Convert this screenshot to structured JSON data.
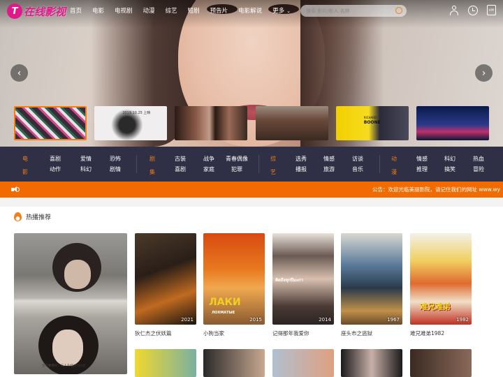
{
  "header": {
    "logo_mark": "T",
    "logo_text": "在线影视",
    "nav": [
      "首页",
      "电影",
      "电视剧",
      "动漫",
      "综艺",
      "短剧",
      "预告片",
      "电影解说",
      "更多"
    ],
    "nav_more_chevron": "⌄",
    "search_placeholder": "搜索 影片/影人 名称",
    "app_icon_text": "APP"
  },
  "hero": {
    "prev": "‹",
    "next": "›",
    "thumbnails": [
      {
        "label": ""
      },
      {
        "label": "2019.10.25 上映"
      },
      {
        "label": ""
      },
      {
        "label": ""
      },
      {
        "label_top": "RICHARD",
        "label": "BOONE"
      },
      {
        "label": ""
      }
    ]
  },
  "categories": [
    {
      "name": "电影",
      "items": [
        "喜剧",
        "爱情",
        "恐怖",
        "动作",
        "科幻",
        "剧情"
      ]
    },
    {
      "name": "剧集",
      "items": [
        "古装",
        "战争",
        "青春偶像",
        "喜剧",
        "家庭",
        "犯罪"
      ]
    },
    {
      "name": "综艺",
      "items": [
        "选秀",
        "情感",
        "访谈",
        "播报",
        "旅游",
        "音乐"
      ]
    },
    {
      "name": "动漫",
      "items": [
        "情感",
        "科幻",
        "热血",
        "推理",
        "搞笑",
        "冒险"
      ]
    }
  ],
  "notice": {
    "text": "公告：欢迎光临美丽影院，请记住我们的网址 www.wy"
  },
  "hot": {
    "title": "热播推荐",
    "big_poster_caption": "生の季節が、二人を結びつけた",
    "cards": [
      {
        "name": "狄仁杰之伏妖篇",
        "year": "2021",
        "poster_text": ""
      },
      {
        "name": "小狗当家",
        "year": "2015",
        "poster_text": "ЛАКИ",
        "poster_text2": "ЛОХМАТЫЕ"
      },
      {
        "name": "记得那年我爱你",
        "year": "2014",
        "poster_text": "คิดถึงทุกปีมะกา"
      },
      {
        "name": "座头市之逃狱",
        "year": "1967",
        "poster_text": ""
      },
      {
        "name": "难兄难弟1982",
        "year": "1982",
        "poster_text": "难兄难弟"
      }
    ]
  }
}
